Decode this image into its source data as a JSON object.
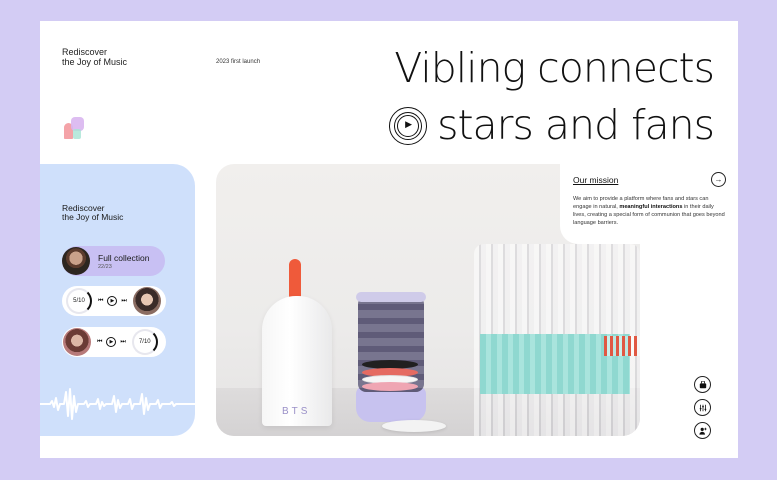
{
  "header": {
    "tagline": "Rediscover\nthe Joy of Music",
    "launch": "2023 first launch",
    "headline_line1": "Vibling connects",
    "headline_line2": "stars and fans",
    "play_glyph": "▶"
  },
  "left_panel": {
    "title": "Rediscover\nthe Joy of Music",
    "collection": {
      "title": "Full collection",
      "count": "22/23"
    },
    "tracks": [
      {
        "progress_label": "5/10",
        "progress": 0.5
      },
      {
        "progress_label": "7/10",
        "progress": 0.7
      }
    ],
    "controls": {
      "prev": "⏮",
      "play": "▶",
      "next": "⏭"
    }
  },
  "product": {
    "brand_mark": "BTS"
  },
  "mission": {
    "title": "Our mission",
    "arrow": "→",
    "body_pre": "We aim to provide a platform where fans and stars can engage in natural, ",
    "body_bold": "meaningful interactions",
    "body_post": " in their daily lives, creating a special form of communion that goes beyond language barriers."
  },
  "side_icons": [
    "bag-icon",
    "equalizer-icon",
    "user-add-icon"
  ],
  "colors": {
    "background": "#d3ccf4",
    "panel_blue": "#cfe0fb",
    "pill_lilac": "#c8c0f3",
    "accent_red": "#ef5a3a"
  }
}
